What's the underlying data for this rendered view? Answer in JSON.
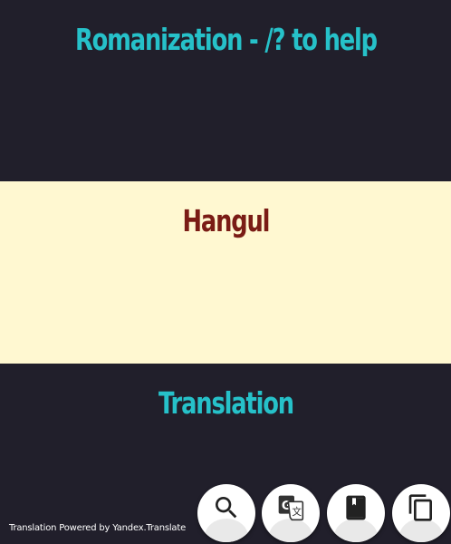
{
  "romanization": {
    "title": "Romanization - /? to help"
  },
  "hangul": {
    "title": "Hangul"
  },
  "translation": {
    "title": "Translation"
  },
  "footer": {
    "credit": "Translation Powered by Yandex.Translate"
  },
  "actions": [
    {
      "icon": "search-icon"
    },
    {
      "icon": "google-translate-icon"
    },
    {
      "icon": "dictionary-book-icon"
    },
    {
      "icon": "copy-icon"
    }
  ],
  "colors": {
    "dark_background": "#211f2b",
    "cream_background": "#fff8d1",
    "accent_teal": "#26c1c9",
    "accent_maroon": "#7a1c15"
  }
}
